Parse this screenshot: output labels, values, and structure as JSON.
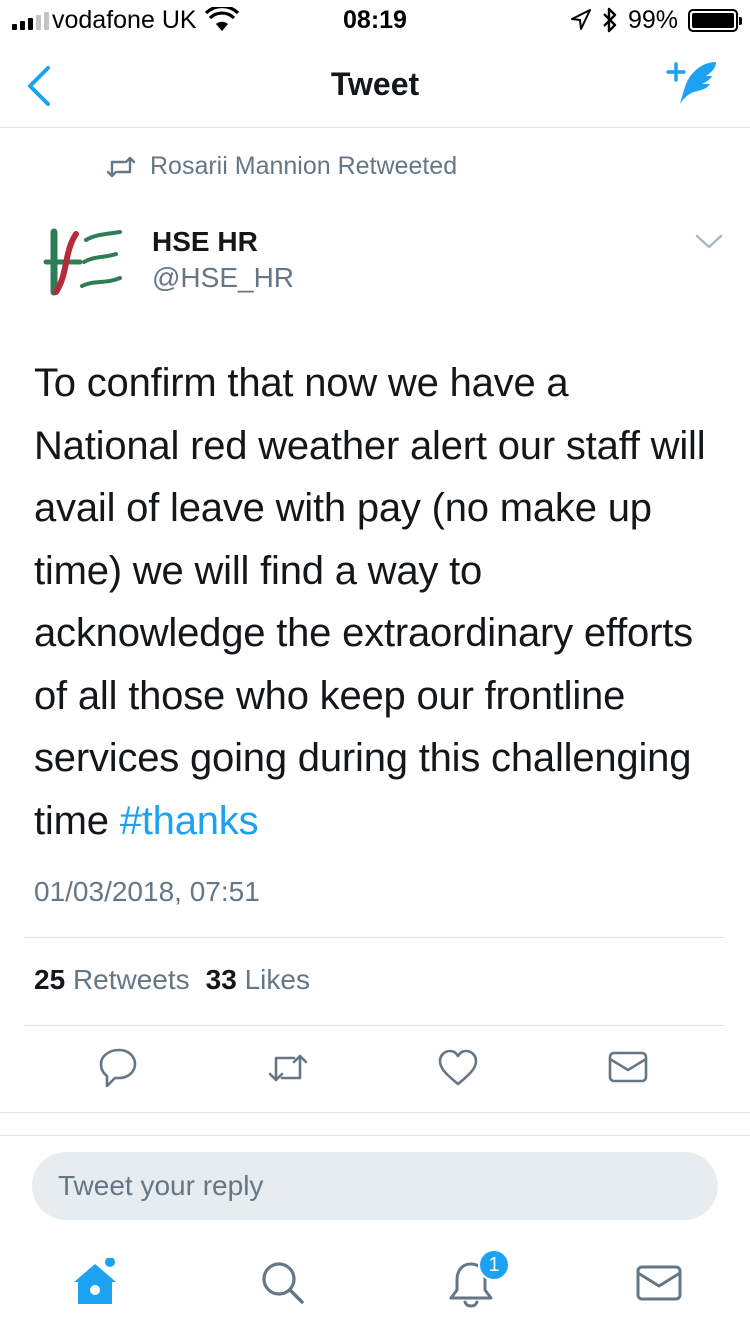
{
  "status_bar": {
    "carrier": "vodafone UK",
    "time": "08:19",
    "battery": "99%"
  },
  "nav": {
    "title": "Tweet"
  },
  "retweet_context": {
    "text": "Rosarii Mannion Retweeted"
  },
  "tweet": {
    "author_name": "HSE HR",
    "author_handle": "@HSE_HR",
    "text_lines": [
      "To confirm that now we have a",
      "National red weather alert our staff will",
      "avail of leave with pay (no make up",
      "time) we will find a way to",
      "acknowledge the extraordinary efforts",
      "of all those who keep our frontline",
      "services going during this challenging",
      "time "
    ],
    "hashtag": "#thanks",
    "timestamp": "01/03/2018, 07:51",
    "retweets_count": "25",
    "retweets_label": "Retweets",
    "likes_count": "33",
    "likes_label": "Likes"
  },
  "reply": {
    "placeholder": "Tweet your reply"
  },
  "tabbar": {
    "notifications_badge": "1"
  },
  "icons": {
    "back": "chevron-left-icon",
    "compose": "compose-tweet-icon",
    "retweet": "retweet-icon",
    "caret": "chevron-down-icon",
    "reply": "reply-icon",
    "like": "heart-icon",
    "message": "envelope-icon",
    "home": "home-icon",
    "search": "search-icon",
    "notifications": "bell-icon"
  },
  "colors": {
    "accent": "#1da1f2",
    "muted": "#657786",
    "text": "#14171a",
    "reply_bg": "#e6ecf0"
  }
}
